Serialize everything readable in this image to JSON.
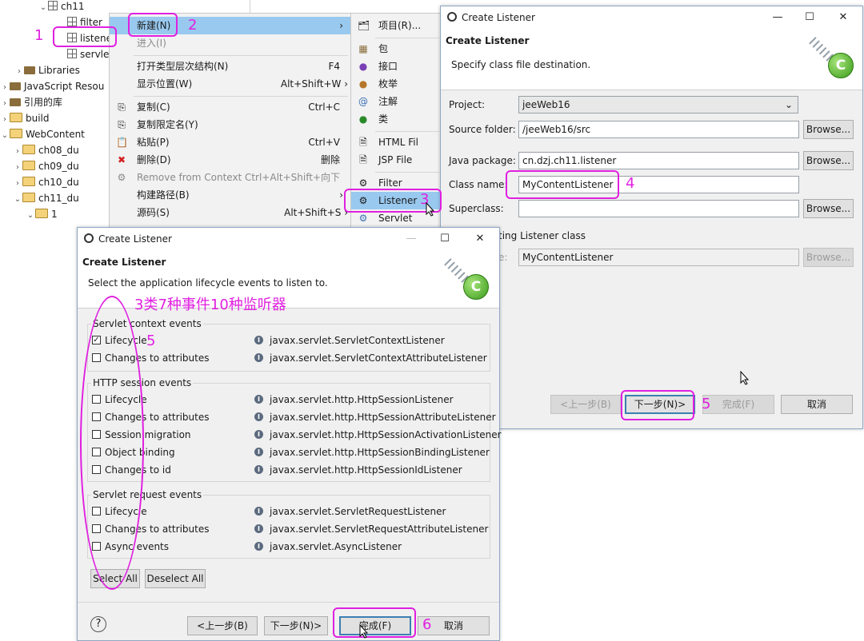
{
  "tree": {
    "items": [
      {
        "chev": "⌄",
        "label": "ch11",
        "icon": "package-icon"
      },
      {
        "chev": "",
        "label": "filter",
        "icon": "package-icon"
      },
      {
        "chev": "",
        "label": "listene",
        "icon": "package-icon"
      },
      {
        "chev": "",
        "label": "servle",
        "icon": "package-icon"
      },
      {
        "chev": "›",
        "label": "Libraries",
        "icon": "library-icon"
      },
      {
        "chev": "›",
        "label": "JavaScript Resou",
        "icon": "library-icon"
      },
      {
        "chev": "›",
        "label": "引用的库",
        "icon": "library-icon"
      },
      {
        "chev": "›",
        "label": "build",
        "icon": "folder-icon"
      },
      {
        "chev": "⌄",
        "label": "WebContent",
        "icon": "folder-icon"
      },
      {
        "chev": "›",
        "label": "ch08_du",
        "icon": "folder-icon"
      },
      {
        "chev": "›",
        "label": "ch09_du",
        "icon": "folder-icon"
      },
      {
        "chev": "›",
        "label": "ch10_du",
        "icon": "folder-icon"
      },
      {
        "chev": "⌄",
        "label": "ch11_du",
        "icon": "folder-icon"
      },
      {
        "chev": "⌄",
        "label": "1",
        "icon": "folder-icon"
      }
    ]
  },
  "context_menu": {
    "items": [
      {
        "label": "新建(N)",
        "shortcut": "›"
      },
      {
        "label": "进入(I)",
        "shortcut": ""
      },
      {
        "label": "打开类型层次结构(N)",
        "shortcut": "F4"
      },
      {
        "label": "显示位置(W)",
        "shortcut": "Alt+Shift+W ›"
      },
      {
        "label": "复制(C)",
        "shortcut": "Ctrl+C"
      },
      {
        "label": "复制限定名(Y)",
        "shortcut": ""
      },
      {
        "label": "粘贴(P)",
        "shortcut": "Ctrl+V"
      },
      {
        "label": "删除(D)",
        "shortcut": "删除"
      },
      {
        "label": "Remove from Context",
        "shortcut": "Ctrl+Alt+Shift+向下"
      },
      {
        "label": "构建路径(B)",
        "shortcut": "›"
      },
      {
        "label": "源码(S)",
        "shortcut": "Alt+Shift+S ›"
      }
    ]
  },
  "submenu": {
    "items": [
      {
        "label": "项目(R)...",
        "icon": "project-icon"
      },
      {
        "label": "包",
        "icon": "package-icon"
      },
      {
        "label": "接口",
        "icon": "interface-icon"
      },
      {
        "label": "枚举",
        "icon": "enum-icon"
      },
      {
        "label": "注解",
        "icon": "annotation-icon"
      },
      {
        "label": "类",
        "icon": "class-icon"
      },
      {
        "label": "HTML Fil",
        "icon": "html-icon"
      },
      {
        "label": "JSP File",
        "icon": "jsp-icon"
      },
      {
        "label": "Filter",
        "icon": "filter-icon"
      },
      {
        "label": "Listener",
        "icon": "listener-icon"
      },
      {
        "label": "Servlet",
        "icon": "servlet-icon"
      }
    ]
  },
  "dialog1": {
    "title": "Create Listener",
    "heading": "Create Listener",
    "subheading": "Specify class file destination.",
    "project_label": "Project:",
    "project_value": "jeeWeb16",
    "source_label": "Source folder:",
    "source_value": "/jeeWeb16/src",
    "package_label": "Java package:",
    "package_value": "cn.dzj.ch11.listener",
    "class_label": "Class name:",
    "class_value": "MyContentListener",
    "super_label": "Superclass:",
    "super_value": "",
    "browse": "Browse...",
    "existing_text": "ting Listener class",
    "existing_label_tail": "e:",
    "existing_value": "MyContentListener",
    "back": "<上一步(B)",
    "next": "下一步(N)>",
    "finish": "完成(F)",
    "cancel": "取消"
  },
  "dialog2": {
    "title": "Create Listener",
    "heading": "Create Listener",
    "subheading": "Select the application lifecycle events to listen to.",
    "groups": [
      {
        "title": "Servlet context events",
        "rows": [
          {
            "label": "Lifecycle",
            "checked": "✓",
            "iface": "javax.servlet.ServletContextListener"
          },
          {
            "label": "Changes to attributes",
            "checked": "",
            "iface": "javax.servlet.ServletContextAttributeListener"
          }
        ]
      },
      {
        "title": "HTTP session events",
        "rows": [
          {
            "label": "Lifecycle",
            "checked": "",
            "iface": "javax.servlet.http.HttpSessionListener"
          },
          {
            "label": "Changes to attributes",
            "checked": "",
            "iface": "javax.servlet.http.HttpSessionAttributeListener"
          },
          {
            "label": "Session migration",
            "checked": "",
            "iface": "javax.servlet.http.HttpSessionActivationListener"
          },
          {
            "label": "Object binding",
            "checked": "",
            "iface": "javax.servlet.http.HttpSessionBindingListener"
          },
          {
            "label": "Changes to id",
            "checked": "",
            "iface": "javax.servlet.http.HttpSessionIdListener"
          }
        ]
      },
      {
        "title": "Servlet request events",
        "rows": [
          {
            "label": "Lifecycle",
            "checked": "",
            "iface": "javax.servlet.ServletRequestListener"
          },
          {
            "label": "Changes to attributes",
            "checked": "",
            "iface": "javax.servlet.ServletRequestAttributeListener"
          },
          {
            "label": "Async events",
            "checked": "",
            "iface": "javax.servlet.AsyncListener"
          }
        ]
      }
    ],
    "select_all": "Select All",
    "deselect_all": "Deselect All",
    "help": "?",
    "back": "<上一步(B)",
    "next": "下一步(N)>",
    "finish": "完成(F)",
    "cancel": "取消"
  },
  "annotations": {
    "n1": "1",
    "n2": "2",
    "n3": "3",
    "n4": "4",
    "n5a": "5",
    "n5b": "5",
    "n6": "6",
    "note": "3类7种事件10种监听器"
  },
  "colors": {
    "annotation": "#e020e0",
    "highlight": "#99c9ef"
  }
}
